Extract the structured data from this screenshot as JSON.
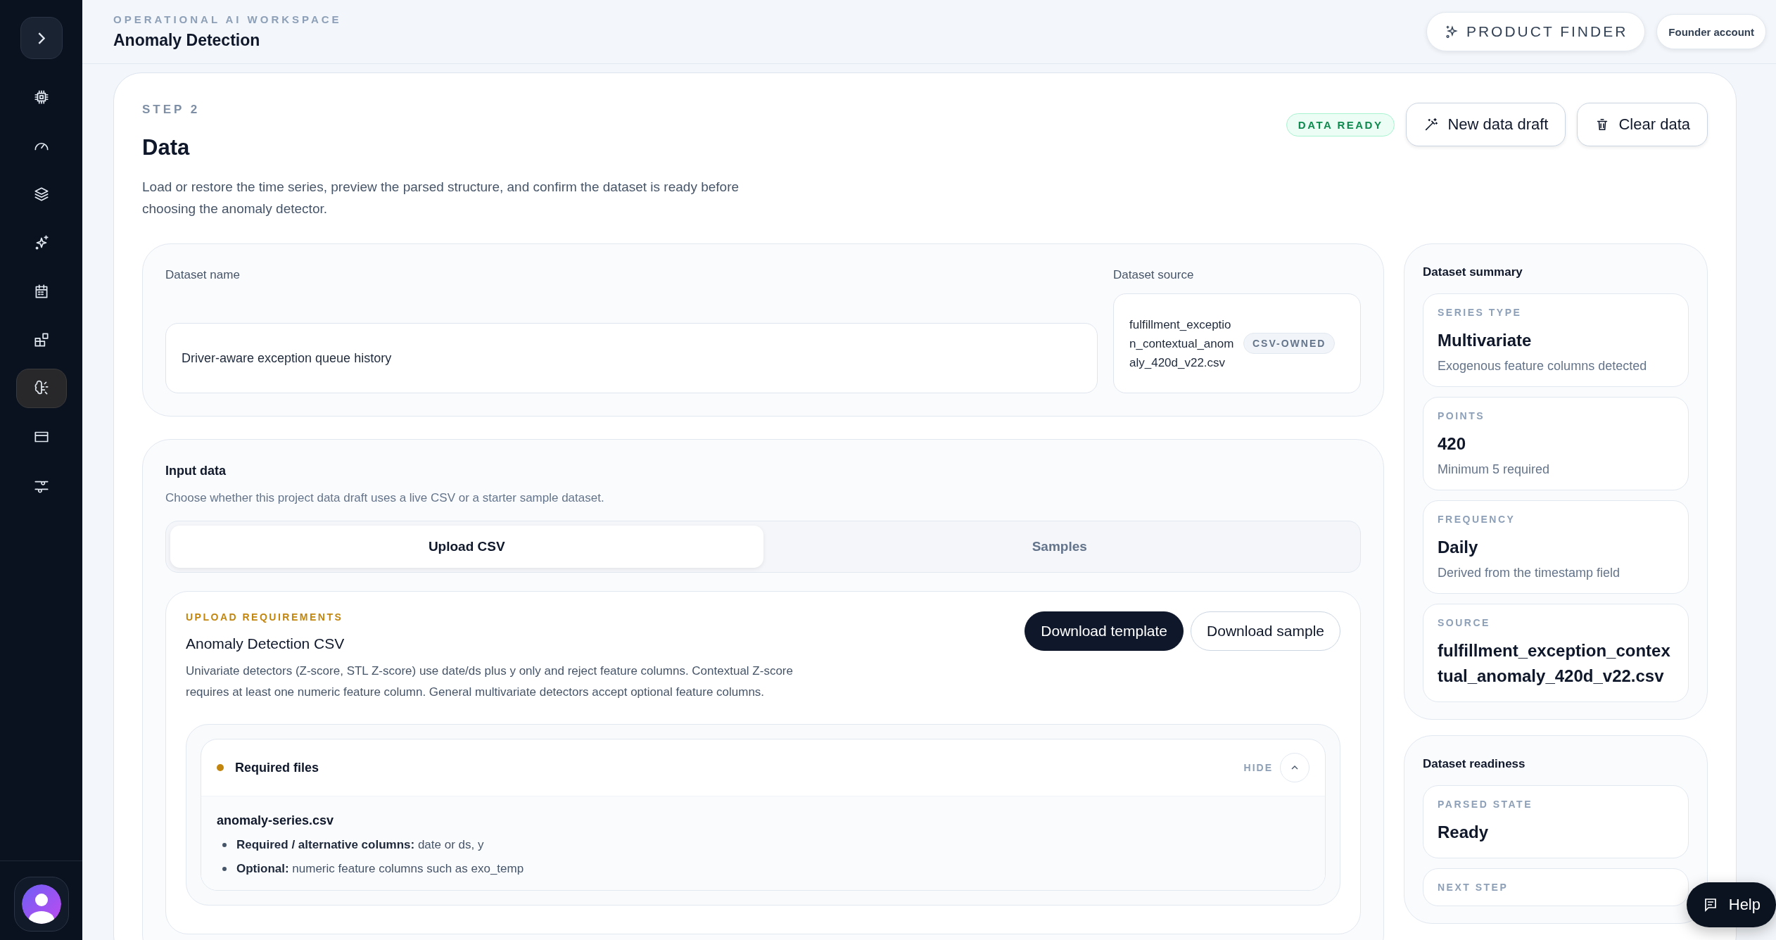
{
  "sidebar": {
    "items": [
      {
        "selected": false
      },
      {
        "selected": false
      },
      {
        "selected": false
      },
      {
        "selected": false
      },
      {
        "selected": false
      },
      {
        "selected": false
      },
      {
        "selected": true
      },
      {
        "selected": false
      },
      {
        "selected": false
      }
    ]
  },
  "header": {
    "eyebrow": "OPERATIONAL AI WORKSPACE",
    "title": "Anomaly Detection",
    "product_finder": "PRODUCT FINDER",
    "account": "Founder account"
  },
  "step": {
    "eyebrow": "STEP 2",
    "title": "Data",
    "description": "Load or restore the time series, preview the parsed structure, and confirm the dataset is ready before choosing the anomaly detector.",
    "status": "DATA READY",
    "actions": [
      "New data draft",
      "Clear data"
    ]
  },
  "dataset": {
    "name_label": "Dataset name",
    "name_value": "Driver-aware exception queue history",
    "source_label": "Dataset source",
    "source_file": "fulfillment_exception_contextual_anomaly_420d_v22.csv",
    "source_badge": "CSV-OWNED"
  },
  "input_data": {
    "title": "Input data",
    "description": "Choose whether this project data draft uses a live CSV or a starter sample dataset.",
    "tabs": [
      {
        "label": "Upload CSV",
        "selected": true
      },
      {
        "label": "Samples",
        "selected": false
      }
    ]
  },
  "requirements": {
    "eyebrow": "UPLOAD REQUIREMENTS",
    "title": "Anomaly Detection CSV",
    "description": "Univariate detectors (Z-score, STL Z-score) use date/ds plus y only and reject feature columns. Contextual Z-score requires at least one numeric feature column. General multivariate detectors accept optional feature columns.",
    "buttons": [
      "Download template",
      "Download sample"
    ],
    "files": {
      "title": "Required files",
      "toggle": "HIDE",
      "expanded": true,
      "file_name": "anomaly-series.csv",
      "bullets": [
        {
          "label": "Required / alternative columns:",
          "value": "date or ds, y"
        },
        {
          "label": "Optional:",
          "value": "numeric feature columns such as exo_temp"
        }
      ]
    }
  },
  "summary": {
    "title": "Dataset summary",
    "cards": [
      {
        "label": "SERIES TYPE",
        "value": "Multivariate",
        "note": "Exogenous feature columns detected"
      },
      {
        "label": "POINTS",
        "value": "420",
        "note": "Minimum 5 required"
      },
      {
        "label": "FREQUENCY",
        "value": "Daily",
        "note": "Derived from the timestamp field"
      },
      {
        "label": "SOURCE",
        "value": "fulfillment_exception_contextual_anomaly_420d_v22.csv"
      }
    ]
  },
  "readiness": {
    "title": "Dataset readiness",
    "cards": [
      {
        "label": "PARSED STATE",
        "value": "Ready"
      },
      {
        "label": "NEXT STEP"
      }
    ]
  },
  "help": "Help"
}
